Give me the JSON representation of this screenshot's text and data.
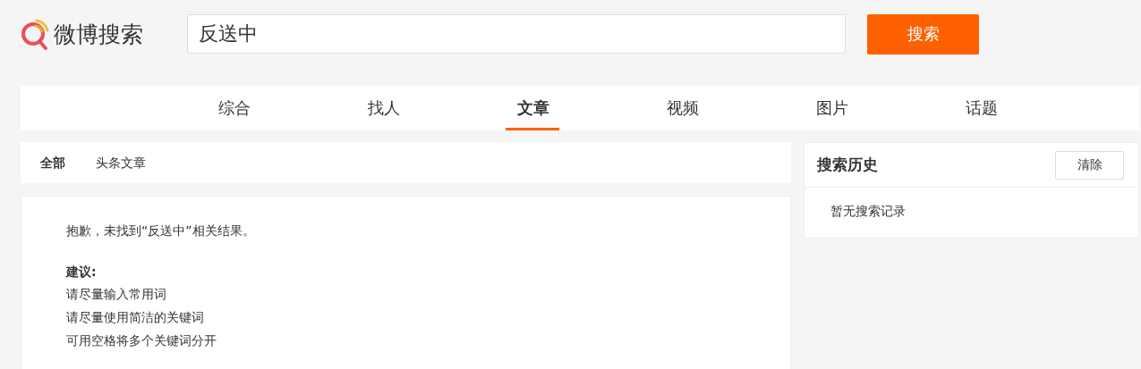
{
  "logo": {
    "text": "微博搜索"
  },
  "search": {
    "value": "反送中",
    "button": "搜索"
  },
  "tabs": [
    {
      "label": "综合",
      "selected": false
    },
    {
      "label": "找人",
      "selected": false
    },
    {
      "label": "文章",
      "selected": true
    },
    {
      "label": "视频",
      "selected": false
    },
    {
      "label": "图片",
      "selected": false
    },
    {
      "label": "话题",
      "selected": false
    }
  ],
  "subtabs": [
    {
      "label": "全部",
      "selected": true
    },
    {
      "label": "头条文章",
      "selected": false
    }
  ],
  "result": {
    "message": "抱歉，未找到“反送中”相关结果。",
    "suggestion_title": "建议:",
    "suggestions": [
      "请尽量输入常用词",
      "请尽量使用简洁的关键词",
      "可用空格将多个关键词分开"
    ]
  },
  "history": {
    "title": "搜索历史",
    "clear_button": "清除",
    "empty_text": "暂无搜索记录"
  }
}
